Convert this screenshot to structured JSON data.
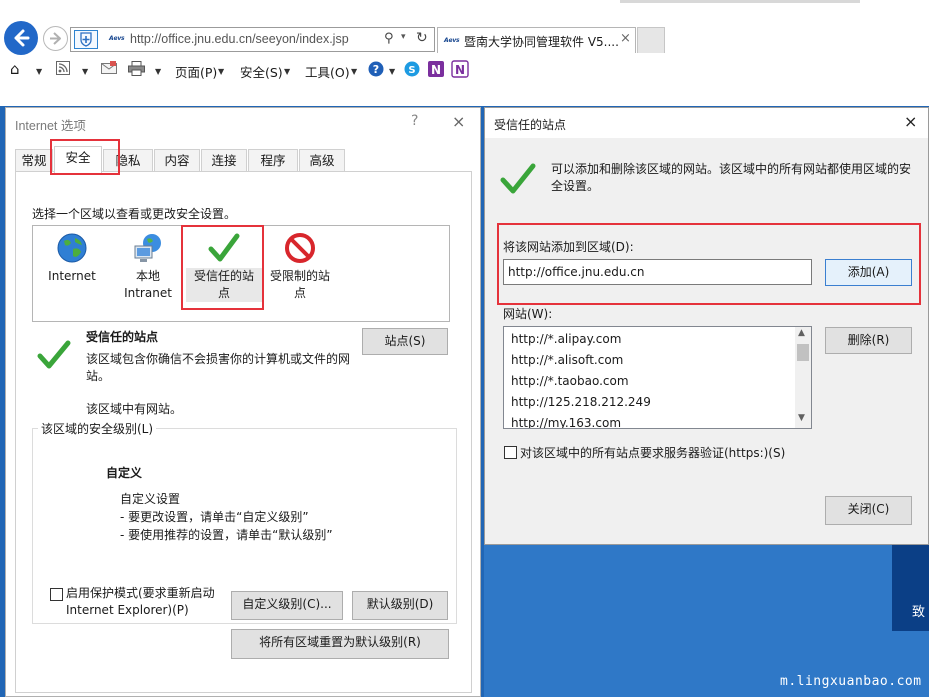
{
  "browser": {
    "address_url": "http://office.jnu.edu.cn/seeyon/index.jsp",
    "favicon_text": "Aevs",
    "tab_title": "暨南大学协同管理软件 V5....",
    "tab_close": "×",
    "commands": {
      "page": "页面(P)",
      "safety": "安全(S)",
      "tools": "工具(O)"
    }
  },
  "internet_options": {
    "title": "Internet 选项",
    "help": "?",
    "close": "×",
    "tabs": [
      "常规",
      "安全",
      "隐私",
      "内容",
      "连接",
      "程序",
      "高级"
    ],
    "zone_instruction": "选择一个区域以查看或更改安全设置。",
    "zones": [
      {
        "line1": "Internet",
        "line2": ""
      },
      {
        "line1": "本地",
        "line2": "Intranet"
      },
      {
        "line1": "受信任的站",
        "line2": "点"
      },
      {
        "line1": "受限制的站",
        "line2": "点"
      }
    ],
    "selected_zone_name": "受信任的站点",
    "zone_description": "该区域包含你确信不会损害你的计算机或文件的网站。",
    "zone_has_sites": "该区域中有网站。",
    "sites_button": "站点(S)",
    "security_level_label": "该区域的安全级别(L)",
    "custom_title": "自定义",
    "custom_lines": [
      "自定义设置",
      "- 要更改设置，请单击“自定义级别”",
      "- 要使用推荐的设置，请单击“默认级别”"
    ],
    "protected_mode_line1": "启用保护模式(要求重新启动",
    "protected_mode_line2": "Internet Explorer)(P)",
    "custom_level_button": "自定义级别(C)...",
    "default_level_button": "默认级别(D)",
    "reset_all_button": "将所有区域重置为默认级别(R)"
  },
  "trusted_sites": {
    "title": "受信任的站点",
    "close": "×",
    "description": "可以添加和删除该区域的网站。该区域中的所有网站都使用区域的安全设置。",
    "add_label": "将该网站添加到区域(D):",
    "add_value": "http://office.jnu.edu.cn",
    "add_button": "添加(A)",
    "sites_label": "网站(W):",
    "sites": [
      "http://*.alipay.com",
      "http://*.alisoft.com",
      "http://*.taobao.com",
      "http://125.218.212.249",
      "http://my.163.com"
    ],
    "remove_button": "删除(R)",
    "https_label": "对该区域中的所有站点要求服务器验证(https:)(S)",
    "close_button": "关闭(C)"
  },
  "background": {
    "right_text": "致",
    "watermark": "m.lingxuanbao.com"
  }
}
